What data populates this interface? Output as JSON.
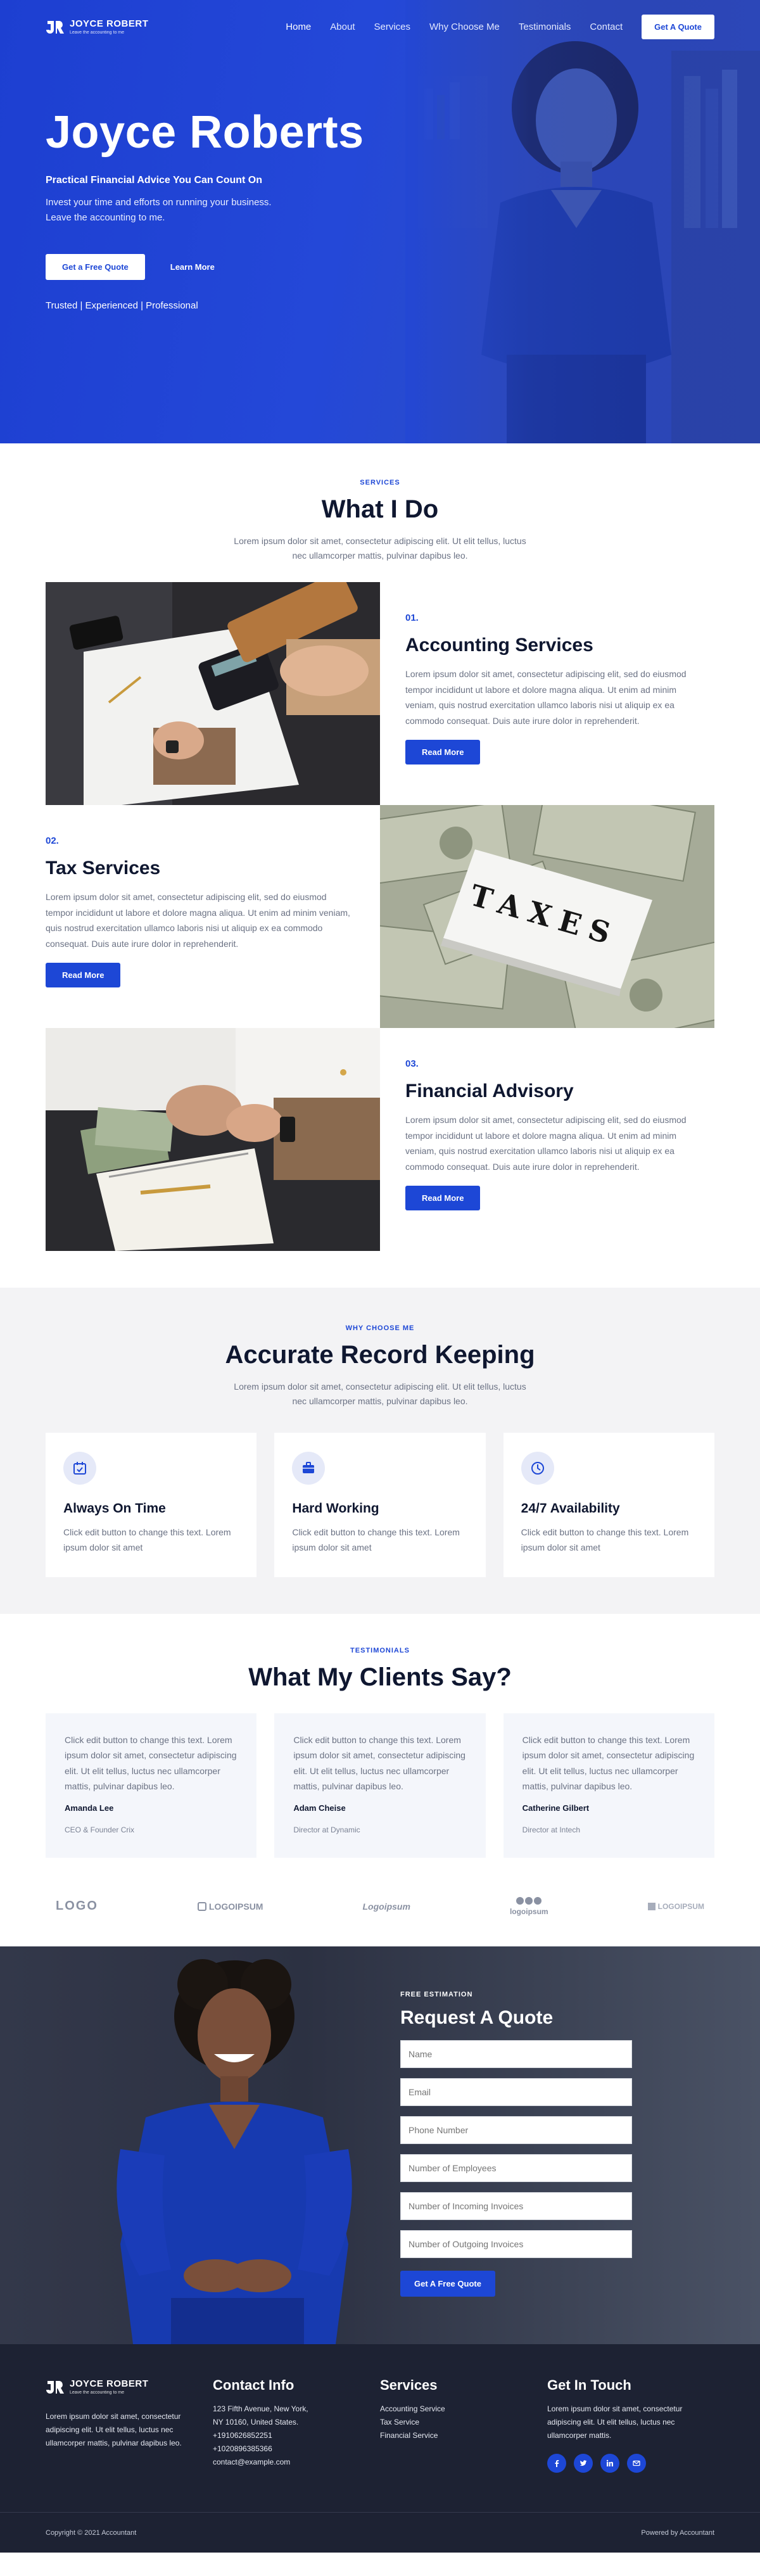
{
  "brand": {
    "name": "JOYCE ROBERT",
    "tagline": "Leave the accounting to me"
  },
  "nav": {
    "items": [
      "Home",
      "About",
      "Services",
      "Why Choose Me",
      "Testimonials",
      "Contact"
    ],
    "cta": "Get A Quote"
  },
  "hero": {
    "title": "Joyce Roberts",
    "subtitle": "Practical Financial Advice You Can Count On",
    "lead": "Invest your time and efforts on running your business. Leave the accounting to me.",
    "primary_btn": "Get a Free Quote",
    "secondary_btn": "Learn More",
    "trusted": "Trusted | Experienced | Professional"
  },
  "services": {
    "label": "SERVICES",
    "title": "What I Do",
    "desc": "Lorem ipsum dolor sit amet, consectetur adipiscing elit. Ut elit tellus, luctus nec ullamcorper mattis, pulvinar dapibus leo.",
    "items": [
      {
        "num": "01.",
        "title": "Accounting Services",
        "body": "Lorem ipsum dolor sit amet, consectetur adipiscing elit, sed do eiusmod tempor incididunt ut labore et dolore magna aliqua. Ut enim ad minim veniam, quis nostrud exercitation ullamco laboris nisi ut aliquip ex ea commodo consequat. Duis aute irure dolor in reprehenderit.",
        "btn": "Read More"
      },
      {
        "num": "02.",
        "title": "Tax Services",
        "body": "Lorem ipsum dolor sit amet, consectetur adipiscing elit, sed do eiusmod tempor incididunt ut labore et dolore magna aliqua. Ut enim ad minim veniam, quis nostrud exercitation ullamco laboris nisi ut aliquip ex ea commodo consequat. Duis aute irure dolor in reprehenderit.",
        "btn": "Read More",
        "image_text": "TAXES"
      },
      {
        "num": "03.",
        "title": "Financial Advisory",
        "body": "Lorem ipsum dolor sit amet, consectetur adipiscing elit, sed do eiusmod tempor incididunt ut labore et dolore magna aliqua. Ut enim ad minim veniam, quis nostrud exercitation ullamco laboris nisi ut aliquip ex ea commodo consequat. Duis aute irure dolor in reprehenderit.",
        "btn": "Read More"
      }
    ]
  },
  "why": {
    "label": "WHY CHOOSE ME",
    "title": "Accurate Record Keeping",
    "desc": "Lorem ipsum dolor sit amet, consectetur adipiscing elit. Ut elit tellus, luctus nec ullamcorper mattis, pulvinar dapibus leo.",
    "features": [
      {
        "icon": "calendar-check-icon",
        "title": "Always On Time",
        "body": "Click edit button to change this text. Lorem ipsum dolor sit amet"
      },
      {
        "icon": "briefcase-icon",
        "title": "Hard Working",
        "body": "Click edit button to change this text. Lorem ipsum dolor sit amet"
      },
      {
        "icon": "clock-icon",
        "title": "24/7 Availability",
        "body": "Click edit button to change this text. Lorem ipsum dolor sit amet"
      }
    ]
  },
  "testimonials": {
    "label": "TESTIMONIALS",
    "title": "What My Clients Say?",
    "items": [
      {
        "body": "Click edit button to change this text. Lorem ipsum dolor sit amet, consectetur adipiscing elit. Ut elit tellus, luctus nec ullamcorper mattis, pulvinar dapibus leo.",
        "name": "Amanda Lee",
        "role": "CEO & Founder Crix"
      },
      {
        "body": "Click edit button to change this text. Lorem ipsum dolor sit amet, consectetur adipiscing elit. Ut elit tellus, luctus nec ullamcorper mattis, pulvinar dapibus leo.",
        "name": "Adam Cheise",
        "role": "Director at Dynamic"
      },
      {
        "body": "Click edit button to change this text. Lorem ipsum dolor sit amet, consectetur adipiscing elit. Ut elit tellus, luctus nec ullamcorper mattis, pulvinar dapibus leo.",
        "name": "Catherine Gilbert",
        "role": "Director at Intech"
      }
    ],
    "client_logos": [
      "LOGO",
      "LOGOIPSUM",
      "Logoipsum",
      "logoipsum",
      "LOGOIPSUM"
    ]
  },
  "quote": {
    "label": "FREE ESTIMATION",
    "title": "Request A Quote",
    "fields": [
      "Name",
      "Email",
      "Phone Number",
      "Number of Employees",
      "Number of Incoming Invoices",
      "Number of Outgoing Invoices"
    ],
    "btn": "Get A Free Quote"
  },
  "footer": {
    "about": "Lorem ipsum dolor sit amet, consectetur adipiscing elit. Ut elit tellus, luctus nec ullamcorper mattis, pulvinar dapibus leo.",
    "contact_title": "Contact Info",
    "contact_lines": [
      "123 Fifth Avenue, New York,",
      "NY 10160, United States.",
      "+1910626852251",
      "+1020896385366",
      "contact@example.com"
    ],
    "services_title": "Services",
    "services": [
      "Accounting Service",
      "Tax Service",
      "Financial Service"
    ],
    "touch_title": "Get In Touch",
    "touch_text": "Lorem ipsum dolor sit amet, consectetur adipiscing elit. Ut elit tellus, luctus nec ullamcorper mattis.",
    "socials": [
      "facebook-icon",
      "twitter-icon",
      "linkedin-icon",
      "email-icon"
    ],
    "copyright": "Copyright © 2021 Accountant",
    "powered": "Powered by Accountant"
  },
  "colors": {
    "primary": "#1d47d6",
    "dark": "#1d2233",
    "light_bg": "#f3f3f5"
  }
}
